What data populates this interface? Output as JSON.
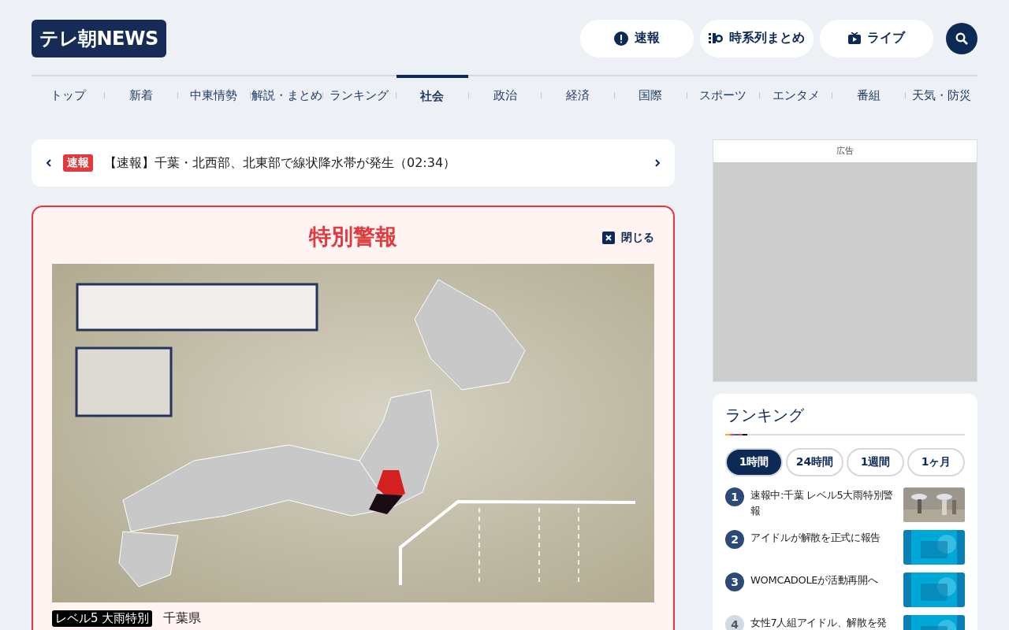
{
  "header": {
    "logo": "テレ朝NEWS",
    "buttons": [
      {
        "label": "速報"
      },
      {
        "label": "時系列まとめ"
      },
      {
        "label": "ライブ"
      }
    ]
  },
  "nav": [
    {
      "label": "トップ",
      "selected": false
    },
    {
      "label": "新着",
      "selected": false
    },
    {
      "label": "中東情勢",
      "selected": false
    },
    {
      "label": "解説・まとめ",
      "selected": false
    },
    {
      "label": "ランキング",
      "selected": false
    },
    {
      "label": "社会",
      "selected": true
    },
    {
      "label": "政治",
      "selected": false
    },
    {
      "label": "経済",
      "selected": false
    },
    {
      "label": "国際",
      "selected": false
    },
    {
      "label": "スポーツ",
      "selected": false
    },
    {
      "label": "エンタメ",
      "selected": false
    },
    {
      "label": "番組",
      "selected": false
    },
    {
      "label": "天気・防災",
      "selected": false
    }
  ],
  "breaking": {
    "badge": "速報",
    "text": "【速報】千葉・北西部、北東部で線状降水帯が発生（02:34）"
  },
  "alert": {
    "title": "特別警報",
    "close": "閉じる",
    "tag": "レベル5 大雨特別",
    "region": "千葉県"
  },
  "ad": {
    "label": "広告"
  },
  "ranking": {
    "title": "ランキング",
    "tabs": [
      {
        "label": "1時間",
        "selected": true
      },
      {
        "label": "24時間",
        "selected": false
      },
      {
        "label": "1週間",
        "selected": false
      },
      {
        "label": "1ヶ月",
        "selected": false
      }
    ],
    "items": [
      {
        "rank": "1",
        "title": "速報中:千葉 レベル5大雨特別警報"
      },
      {
        "rank": "2",
        "title": "アイドルが解散を正式に報告"
      },
      {
        "rank": "3",
        "title": "WOMCADOLEが活動再開へ"
      },
      {
        "rank": "4",
        "title": "女性7人組アイドル、解散を発"
      }
    ]
  }
}
